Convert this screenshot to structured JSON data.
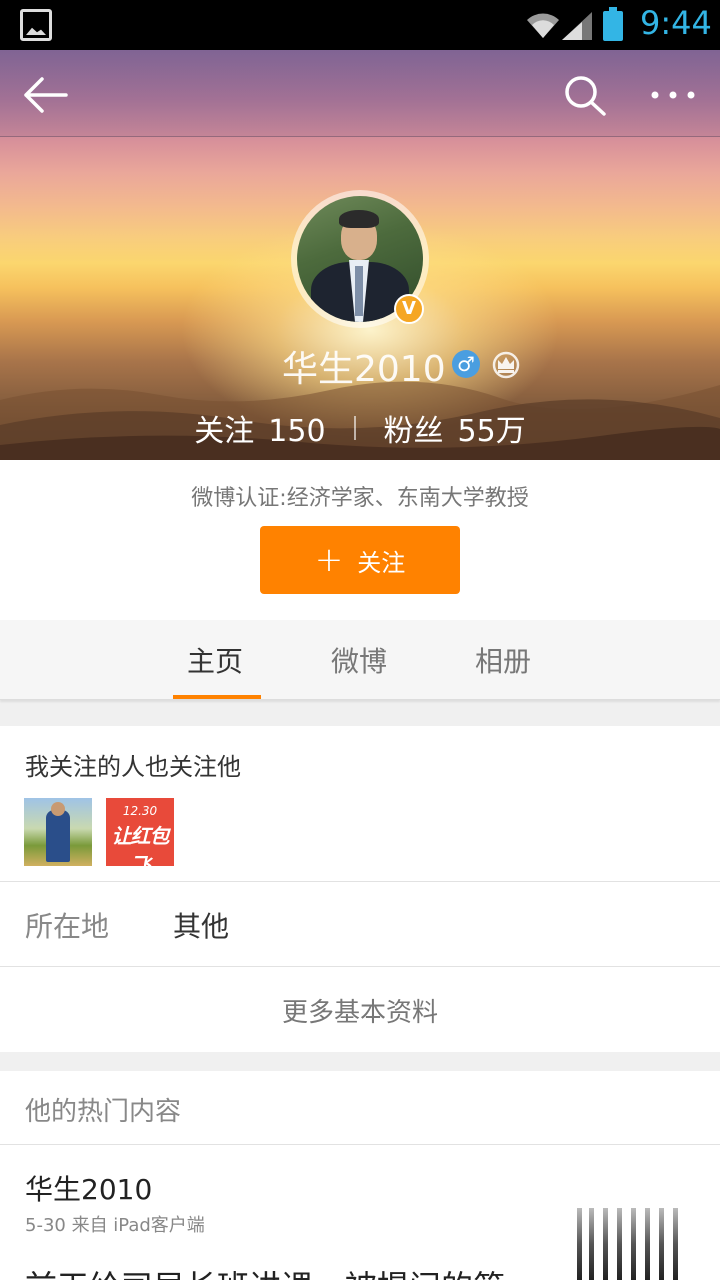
{
  "status_bar": {
    "time": "9:44"
  },
  "header": {
    "back_icon": "arrow-left-icon",
    "search_icon": "search-icon",
    "more_icon": "more-dots-icon"
  },
  "profile": {
    "name": "华生2010",
    "verified_badge": "V",
    "gender_symbol": "♂",
    "following_label": "关注",
    "following_count": "150",
    "followers_label": "粉丝",
    "followers_count": "55万",
    "verification": "微博认证:经济学家、东南大学教授",
    "follow_button": "关注",
    "follow_plus": "+"
  },
  "tabs": [
    {
      "label": "主页",
      "active": true
    },
    {
      "label": "微博",
      "active": false
    },
    {
      "label": "相册",
      "active": false
    }
  ],
  "friends": {
    "title": "我关注的人也关注他",
    "avatars": [
      {
        "name": "friend-avatar-1"
      },
      {
        "name": "friend-avatar-2",
        "date_text": "12.30",
        "slogan": "让红包飞"
      }
    ]
  },
  "info": {
    "location_label": "所在地",
    "location_value": "其他",
    "more_info": "更多基本资料"
  },
  "hot": {
    "title": "他的热门内容",
    "post": {
      "author": "华生2010",
      "meta": "5-30   来自 iPad客户端",
      "text": "前天给司局长班讲课，被提问的第"
    }
  },
  "colors": {
    "accent": "#ff8200",
    "status_blue": "#33b5e5"
  }
}
